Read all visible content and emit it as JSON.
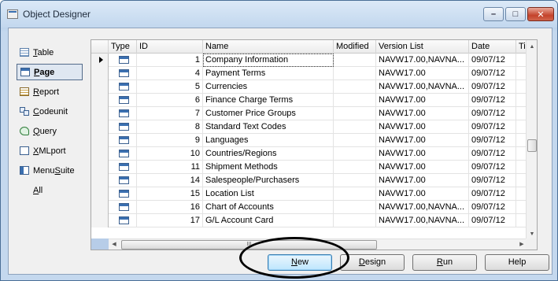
{
  "window": {
    "title": "Object Designer",
    "controls": {
      "minimize": "–",
      "maximize": "□",
      "close": "✕"
    }
  },
  "sidebar": {
    "items": [
      {
        "label_pre": "",
        "label_ul": "T",
        "label_post": "able",
        "icon": "table-icon"
      },
      {
        "label_pre": "",
        "label_ul": "P",
        "label_post": "age",
        "icon": "page-icon",
        "selected": true
      },
      {
        "label_pre": "",
        "label_ul": "R",
        "label_post": "eport",
        "icon": "report-icon"
      },
      {
        "label_pre": "",
        "label_ul": "C",
        "label_post": "odeunit",
        "icon": "codeunit-icon"
      },
      {
        "label_pre": "",
        "label_ul": "Q",
        "label_post": "uery",
        "icon": "query-icon"
      },
      {
        "label_pre": "",
        "label_ul": "X",
        "label_post": "MLport",
        "icon": "xmlport-icon"
      },
      {
        "label_pre": "Menu",
        "label_ul": "S",
        "label_post": "uite",
        "icon": "menusuite-icon"
      },
      {
        "label_pre": "",
        "label_ul": "A",
        "label_post": "ll",
        "icon": ""
      }
    ]
  },
  "grid": {
    "columns": [
      "Type",
      "ID",
      "Name",
      "Modified",
      "Version List",
      "Date",
      "Ti"
    ],
    "rows": [
      {
        "id": "1",
        "name": "Company Information",
        "modified": "",
        "version": "NAVW17.00,NAVNA...",
        "date": "09/07/12",
        "current": true
      },
      {
        "id": "4",
        "name": "Payment Terms",
        "modified": "",
        "version": "NAVW17.00",
        "date": "09/07/12"
      },
      {
        "id": "5",
        "name": "Currencies",
        "modified": "",
        "version": "NAVW17.00,NAVNA...",
        "date": "09/07/12"
      },
      {
        "id": "6",
        "name": "Finance Charge Terms",
        "modified": "",
        "version": "NAVW17.00",
        "date": "09/07/12"
      },
      {
        "id": "7",
        "name": "Customer Price Groups",
        "modified": "",
        "version": "NAVW17.00",
        "date": "09/07/12"
      },
      {
        "id": "8",
        "name": "Standard Text Codes",
        "modified": "",
        "version": "NAVW17.00",
        "date": "09/07/12"
      },
      {
        "id": "9",
        "name": "Languages",
        "modified": "",
        "version": "NAVW17.00",
        "date": "09/07/12"
      },
      {
        "id": "10",
        "name": "Countries/Regions",
        "modified": "",
        "version": "NAVW17.00",
        "date": "09/07/12"
      },
      {
        "id": "11",
        "name": "Shipment Methods",
        "modified": "",
        "version": "NAVW17.00",
        "date": "09/07/12"
      },
      {
        "id": "14",
        "name": "Salespeople/Purchasers",
        "modified": "",
        "version": "NAVW17.00",
        "date": "09/07/12"
      },
      {
        "id": "15",
        "name": "Location List",
        "modified": "",
        "version": "NAVW17.00",
        "date": "09/07/12"
      },
      {
        "id": "16",
        "name": "Chart of Accounts",
        "modified": "",
        "version": "NAVW17.00,NAVNA...",
        "date": "09/07/12"
      },
      {
        "id": "17",
        "name": "G/L Account Card",
        "modified": "",
        "version": "NAVW17.00,NAVNA...",
        "date": "09/07/12"
      }
    ],
    "hscroll_grip": "III"
  },
  "buttons": [
    {
      "pre": "",
      "ul": "N",
      "post": "ew",
      "name": "new-button",
      "default": true
    },
    {
      "pre": "",
      "ul": "D",
      "post": "esign",
      "name": "design-button"
    },
    {
      "pre": "",
      "ul": "R",
      "post": "un",
      "name": "run-button"
    },
    {
      "pre": "Help",
      "ul": "",
      "post": "",
      "name": "help-button"
    }
  ]
}
